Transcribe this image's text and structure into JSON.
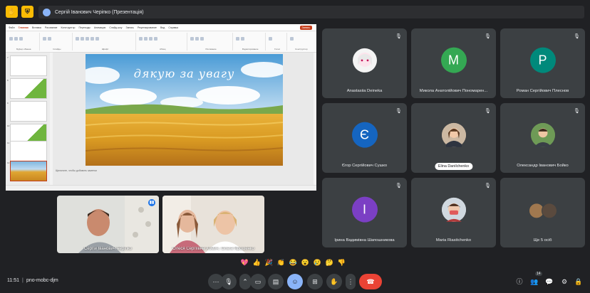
{
  "topbar": {
    "presenter_title": "Сергій Іванович Черіпко (Презентація)",
    "icons": [
      "folder-hand-icon",
      "lock-person-icon"
    ]
  },
  "presentation": {
    "tabs": [
      "Файл",
      "Главная",
      "Вставка",
      "Рисование",
      "Конструктор",
      "Переходы",
      "Анимация",
      "Слайд-шоу",
      "Запись",
      "Рецензирование",
      "Вид",
      "Справка"
    ],
    "active_tab": "Главная",
    "record_label": "Запись",
    "ribbon_groups": [
      "Буфер обмена",
      "Слайды",
      "Шрифт",
      "Абзац",
      "Рисование",
      "Редактирование",
      "Голос",
      "Конструктор"
    ],
    "slide_numbers": [
      "7",
      "8",
      "9",
      "10",
      "11",
      "12"
    ],
    "slide_title": "дякую за увагу",
    "notes_placeholder": "Щелкните, чтобы добавить заметки",
    "colors": {
      "accent": "#c43e1c"
    }
  },
  "participants": [
    {
      "name": "Anastasiia Deineka",
      "avatar_type": "photo",
      "avatar_color": "#f4f4f4",
      "muted": true
    },
    {
      "name": "Микола Анатолійович Пономарен...",
      "avatar_letter": "M",
      "avatar_color": "#34a853",
      "muted": true
    },
    {
      "name": "Роман Сергійович Плеснов",
      "avatar_letter": "P",
      "avatar_color": "#00897b",
      "muted": true
    },
    {
      "name": "Єгор Сергійович Сушко",
      "avatar_letter": "Є",
      "avatar_color": "#1565c0",
      "muted": true
    },
    {
      "name": "Elina Danilchenko",
      "avatar_type": "photo",
      "avatar_color": "#c9a98a",
      "muted": true,
      "pill": true
    },
    {
      "name": "Олександр Іванович Бойко",
      "avatar_type": "photo",
      "avatar_color": "#5f8a4a",
      "muted": true
    },
    {
      "name": "Ірина Вадимівна Шапошникова",
      "avatar_letter": "І",
      "avatar_color": "#7b3fc4",
      "muted": true
    },
    {
      "name": "Maria Riasitchenko",
      "avatar_type": "photo",
      "avatar_color": "#d7dfe6",
      "muted": true
    },
    {
      "name": "Ще 5 осіб",
      "avatar_type": "group",
      "muted": false
    }
  ],
  "cameras": [
    {
      "name": "Сергій Іванович Черіпко",
      "speaking": true
    },
    {
      "name": "Олеся Сергіївна Хомич, Ольга Ярошенко",
      "speaking": false
    }
  ],
  "reactions": [
    "💖",
    "👍",
    "🎉",
    "👏",
    "😂",
    "😮",
    "😢",
    "🤔",
    "👎"
  ],
  "bottombar": {
    "time": "11:51",
    "separator": "|",
    "meeting_code": "pno-mobc-djm",
    "participant_count": "14",
    "controls": [
      "more-options-icon",
      "mic-icon",
      "chevron-icon",
      "camera-icon",
      "captions-icon",
      "emoji-icon",
      "present-icon",
      "raise-hand-icon",
      "more-vert-icon",
      "end-call-icon"
    ],
    "right_icons": [
      "info-icon",
      "people-icon",
      "chat-icon",
      "activities-icon",
      "lock-icon"
    ]
  }
}
